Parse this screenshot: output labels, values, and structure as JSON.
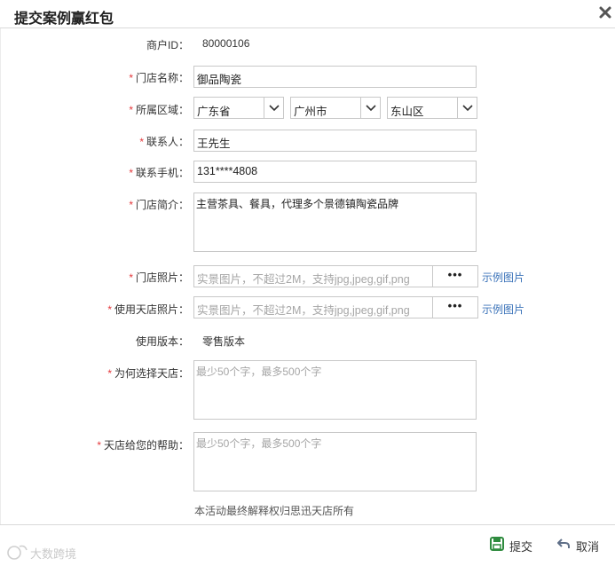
{
  "dialog": {
    "title": "提交案例赢红包",
    "close_icon": "close-icon"
  },
  "form": {
    "merchant_id": {
      "label": "商户ID：",
      "value": "80000106"
    },
    "store_name": {
      "required": "*",
      "label": "门店名称：",
      "value": "御品陶瓷"
    },
    "region": {
      "required": "*",
      "label": "所属区域：",
      "province": "广东省",
      "city": "广州市",
      "district": "东山区"
    },
    "contact": {
      "required": "*",
      "label": "联系人：",
      "value": "王先生"
    },
    "phone": {
      "required": "*",
      "label": "联系手机：",
      "value": "131****4808"
    },
    "intro": {
      "required": "*",
      "label": "门店简介：",
      "value": "主营茶具、餐具，代理多个景德镇陶瓷品牌"
    },
    "store_photo": {
      "required": "*",
      "label": "门店照片：",
      "placeholder": "实景图片，不超过2M，支持jpg,jpeg,gif,png",
      "browse": "•••",
      "sample": "示例图片"
    },
    "usage_photo": {
      "required": "*",
      "label": "使用天店照片：",
      "placeholder": "实景图片，不超过2M，支持jpg,jpeg,gif,png",
      "browse": "•••",
      "sample": "示例图片"
    },
    "version": {
      "label": "使用版本：",
      "value": "零售版本"
    },
    "why": {
      "required": "*",
      "label": "为何选择天店：",
      "placeholder": "最少50个字，最多500个字"
    },
    "help": {
      "required": "*",
      "label": "天店给您的帮助：",
      "placeholder": "最少50个字，最多500个字"
    },
    "note": "本活动最终解释权归思迅天店所有"
  },
  "footer": {
    "submit": "提交",
    "cancel": "取消"
  },
  "watermark": "大数跨境",
  "colors": {
    "required": "#e4393c",
    "link": "#3b73b9",
    "border": "#c8c8c8",
    "submit_icon": "#2e8b3e"
  }
}
